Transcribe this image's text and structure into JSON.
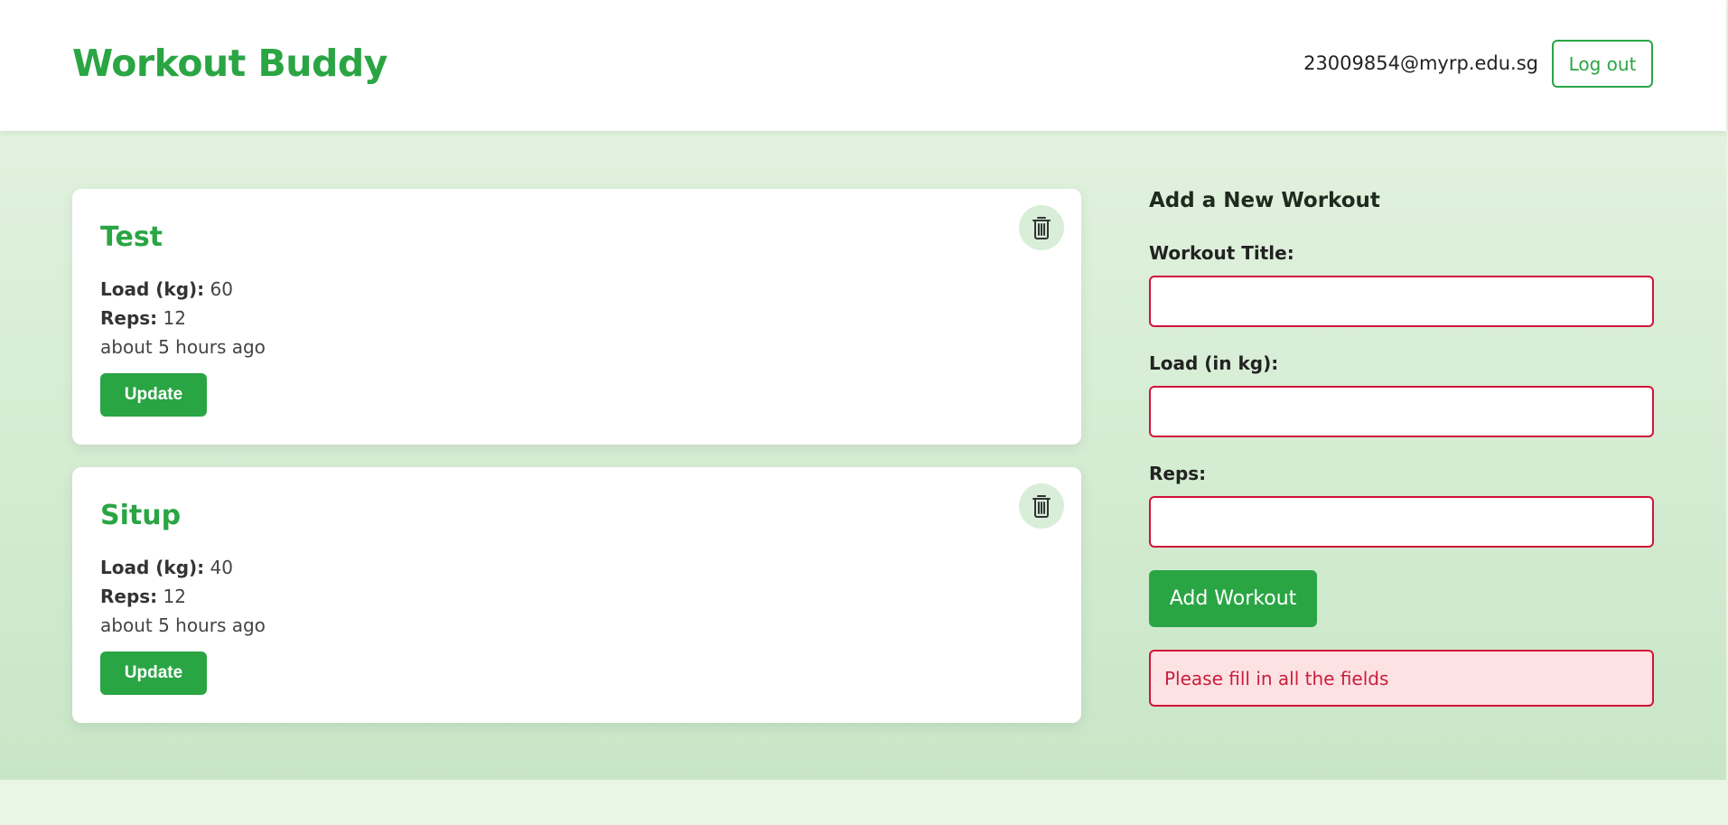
{
  "header": {
    "brand": "Workout Buddy",
    "user_email": "23009854@myrp.edu.sg",
    "logout_label": "Log out"
  },
  "workouts": [
    {
      "title": "Test",
      "load_label": "Load (kg):",
      "load_value": "60",
      "reps_label": "Reps:",
      "reps_value": "12",
      "time": "about 5 hours ago",
      "update_label": "Update"
    },
    {
      "title": "Situp",
      "load_label": "Load (kg):",
      "load_value": "40",
      "reps_label": "Reps:",
      "reps_value": "12",
      "time": "about 5 hours ago",
      "update_label": "Update"
    }
  ],
  "form": {
    "title": "Add a New Workout",
    "title_label": "Workout Title:",
    "title_value": "",
    "load_label": "Load (in kg):",
    "load_value": "",
    "reps_label": "Reps:",
    "reps_value": "",
    "submit_label": "Add Workout",
    "error": "Please fill in all the fields"
  },
  "colors": {
    "brand": "#2aa544",
    "error": "#d1133a",
    "error_bg": "#fde2e4"
  },
  "icons": {
    "delete": "trash-icon"
  }
}
